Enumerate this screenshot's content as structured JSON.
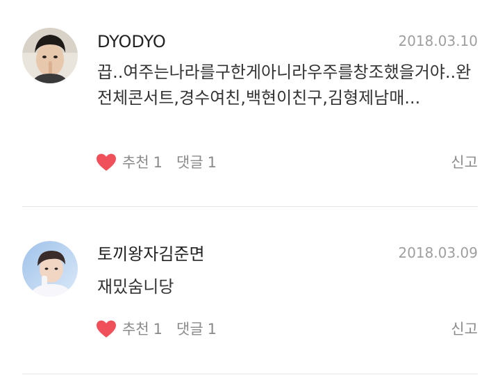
{
  "comments": [
    {
      "author": "DYODYO",
      "date": "2018.03.10",
      "text": "끕..여주는나라를구한게아니라우주를창조했을거야..완전체콘서트,경수여친,백현이친구,김형제남매...",
      "like_label": "추천",
      "like_count": "1",
      "reply_label": "댓글",
      "reply_count": "1",
      "report_label": "신고"
    },
    {
      "author": "토끼왕자김준면",
      "date": "2018.03.09",
      "text": "재밌숨니당",
      "like_label": "추천",
      "like_count": "1",
      "reply_label": "댓글",
      "reply_count": "1",
      "report_label": "신고"
    }
  ],
  "colors": {
    "heart": "#f0505a",
    "muted_text": "#8a8a8a",
    "date_text": "#9e9e9e",
    "divider": "#e6e6e6"
  },
  "icons": {
    "like": "heart-icon",
    "avatar_1": "profile-photo",
    "avatar_2": "profile-photo"
  }
}
